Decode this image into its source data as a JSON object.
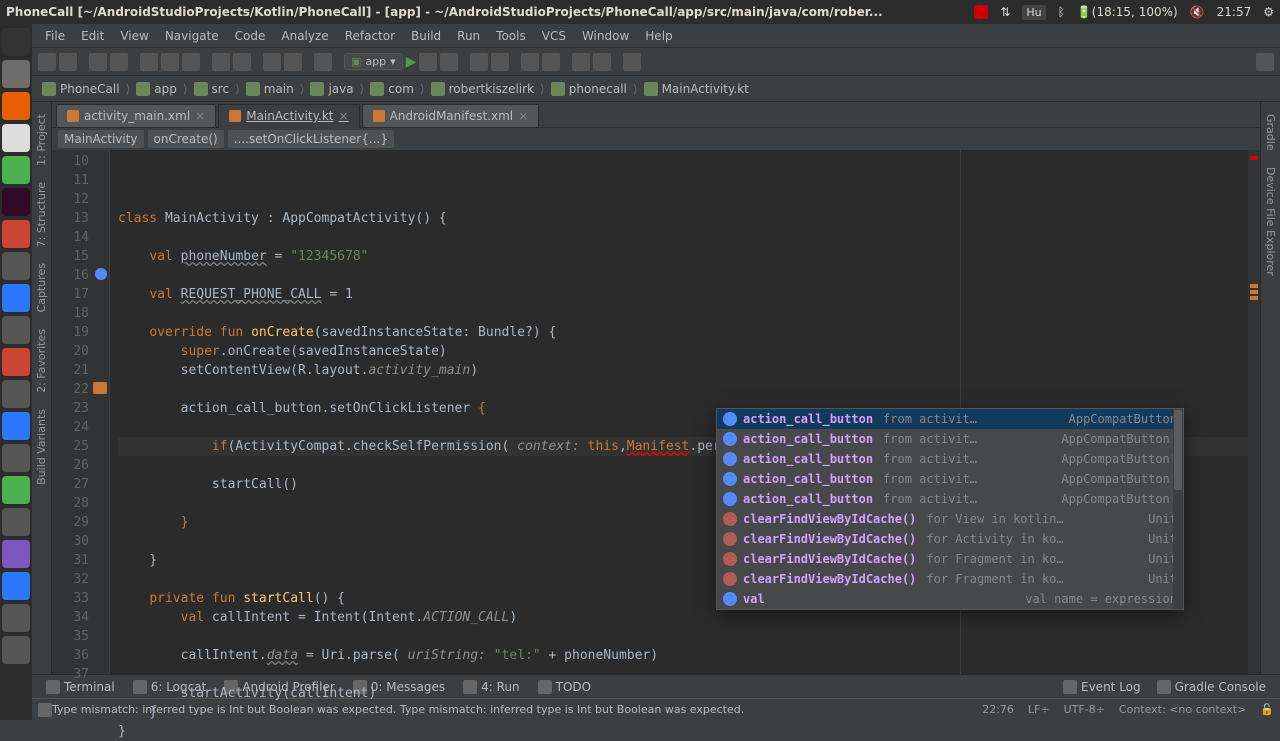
{
  "ubuntu_panel": {
    "title": "PhoneCall [~/AndroidStudioProjects/Kotlin/PhoneCall] - [app] - ~/AndroidStudioProjects/PhoneCall/app/src/main/java/com/rober...",
    "lang": "Hu",
    "battery": "(18:15, 100%)",
    "time": "21:57"
  },
  "menu": [
    "File",
    "Edit",
    "View",
    "Navigate",
    "Code",
    "Analyze",
    "Refactor",
    "Build",
    "Run",
    "Tools",
    "VCS",
    "Window",
    "Help"
  ],
  "run_config": "app",
  "breadcrumbs": [
    "PhoneCall",
    "app",
    "src",
    "main",
    "java",
    "com",
    "robertkiszelirk",
    "phonecall",
    "MainActivity.kt"
  ],
  "tabs": [
    {
      "label": "activity_main.xml",
      "active": false
    },
    {
      "label": "MainActivity.kt",
      "active": true
    },
    {
      "label": "AndroidManifest.xml",
      "active": false
    }
  ],
  "code_crumbs": [
    "MainActivity",
    "onCreate()",
    "....setOnClickListener{...}"
  ],
  "left_tools": [
    "1: Project",
    "7: Structure",
    "Captures",
    "2: Favorites",
    "Build Variants"
  ],
  "right_tools": [
    "Gradle",
    "Device File Explorer"
  ],
  "gutter_start": 10,
  "code_lines": [
    {
      "html": "<span class='kw'>class</span> MainActivity : AppCompatActivity() {"
    },
    {
      "html": ""
    },
    {
      "html": "    <span class='kw'>val</span> <span class='err2'>phoneNumber</span> = <span class='str'>\"12345678\"</span>"
    },
    {
      "html": ""
    },
    {
      "html": "    <span class='kw'>val</span> <span class='err2'>REQUEST_PHONE_CALL</span> = 1"
    },
    {
      "html": ""
    },
    {
      "html": "    <span class='kw'>override fun</span> <span class='fn'>onCreate</span>(savedInstanceState: Bundle?) {",
      "icon": "override"
    },
    {
      "html": "        <span class='kw'>super</span>.onCreate(savedInstanceState)"
    },
    {
      "html": "        setContentView(R.layout.<span class='param'>activity_main</span>)"
    },
    {
      "html": ""
    },
    {
      "html": "        action_call_button.setOnClickListener <span class='kw'>{</span>"
    },
    {
      "html": ""
    },
    {
      "html": "            <span class='kw'>if</span>(ActivityCompat.checkSelfPermission( <span class='param'>context:</span> <span class='kw'>this</span>,<span class='err'>Manifest</span>.permission.))",
      "caret": true,
      "icon": "warn"
    },
    {
      "html": ""
    },
    {
      "html": "            startCall()"
    },
    {
      "html": ""
    },
    {
      "html": "        <span class='kw'>}</span>"
    },
    {
      "html": ""
    },
    {
      "html": "    }"
    },
    {
      "html": ""
    },
    {
      "html": "    <span class='kw'>private fun</span> <span class='fn'>startCall</span>() {"
    },
    {
      "html": "        <span class='kw'>val</span> callIntent = Intent(Intent.<span class='param'>ACTION_CALL</span>)"
    },
    {
      "html": ""
    },
    {
      "html": "        callIntent.<span class='param err2'>data</span> = Uri.parse( <span class='param'>uriString:</span> <span class='str'>\"tel:\"</span> + phoneNumber)"
    },
    {
      "html": ""
    },
    {
      "html": "        startActivity(callIntent)"
    },
    {
      "html": "    }"
    },
    {
      "html": "}"
    }
  ],
  "autocomplete": [
    {
      "name": "action_call_button",
      "from": "from activit…",
      "type": "AppCompatButton",
      "kind": "prop",
      "sel": true
    },
    {
      "name": "action_call_button",
      "from": "from activit…",
      "type": "AppCompatButton!",
      "kind": "prop"
    },
    {
      "name": "action_call_button",
      "from": "from activit…",
      "type": "AppCompatButton!",
      "kind": "prop"
    },
    {
      "name": "action_call_button",
      "from": "from activit…",
      "type": "AppCompatButton!",
      "kind": "prop"
    },
    {
      "name": "action_call_button",
      "from": "from activit…",
      "type": "AppCompatButton!",
      "kind": "prop"
    },
    {
      "name": "clearFindViewByIdCache()",
      "from": "for View in kotlin…",
      "type": "Unit",
      "kind": "fn"
    },
    {
      "name": "clearFindViewByIdCache()",
      "from": "for Activity in ko…",
      "type": "Unit",
      "kind": "fn"
    },
    {
      "name": "clearFindViewByIdCache()",
      "from": "for Fragment in ko…",
      "type": "Unit",
      "kind": "fn"
    },
    {
      "name": "clearFindViewByIdCache()",
      "from": "for Fragment in ko…",
      "type": "Unit",
      "kind": "fn"
    },
    {
      "name": "val",
      "from": "",
      "type": "val name = expression",
      "kind": "kw"
    }
  ],
  "bottom_tools": {
    "left": [
      "Terminal",
      "6: Logcat",
      "Android Profiler",
      "0: Messages",
      "4: Run",
      "TODO"
    ],
    "right": [
      "Event Log",
      "Gradle Console"
    ]
  },
  "status": {
    "msg": "Type mismatch: inferred type is Int but Boolean was expected. Type mismatch: inferred type is Int but Boolean was expected.",
    "pos": "22:76",
    "lf": "LF÷",
    "enc": "UTF-8÷",
    "ctx": "Context: <no context>"
  }
}
